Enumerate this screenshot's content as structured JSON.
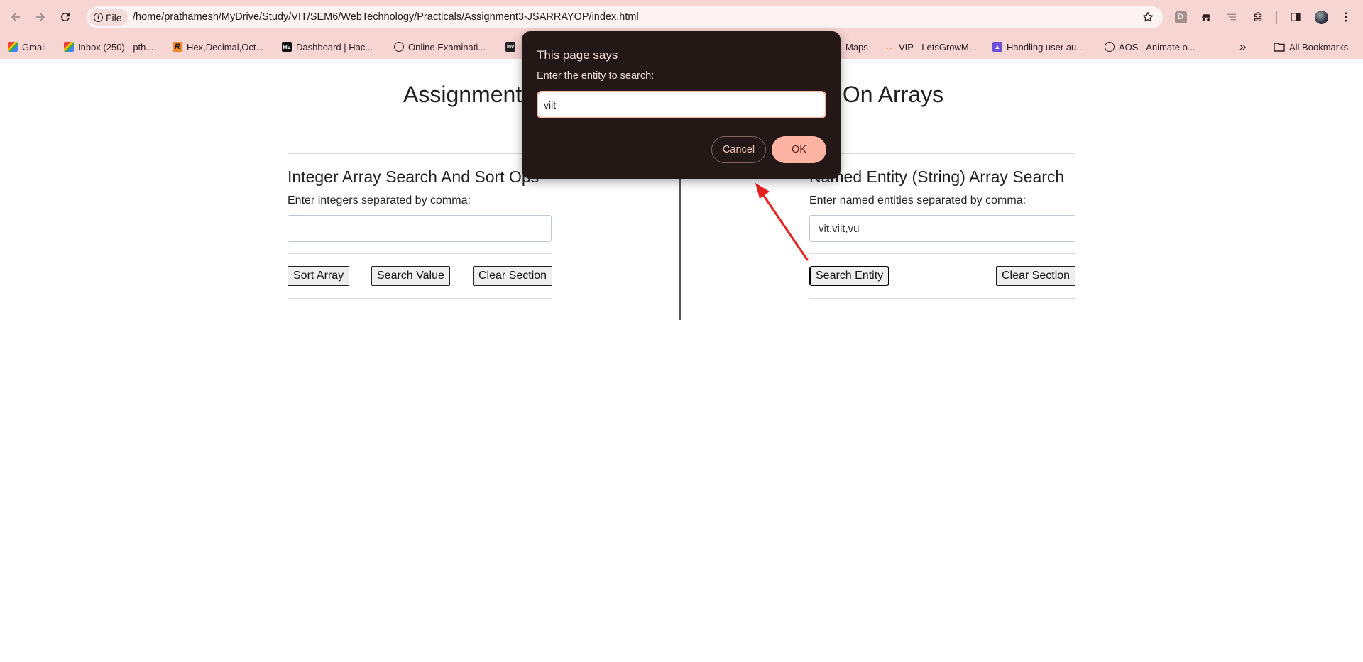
{
  "browser": {
    "site_chip": "File",
    "url": "/home/prathamesh/MyDrive/Study/VIT/SEM6/WebTechnology/Practicals/Assignment3-JSARRAYOP/index.html",
    "extension_letter": "D",
    "bookmarks": [
      {
        "label": "Gmail",
        "icon": "gmail-icon"
      },
      {
        "label": "Inbox (250) - pth...",
        "icon": "gmail-icon"
      },
      {
        "label": "Hex,Decimal,Oct...",
        "icon": "r-logo-icon"
      },
      {
        "label": "Dashboard | Hac...",
        "icon": "hackerearth-icon"
      },
      {
        "label": "Online Examinati...",
        "icon": "globe-icon"
      },
      {
        "label": "Maps",
        "icon": "maps-icon"
      },
      {
        "label": "VIP - LetsGrowM...",
        "icon": "arrow-icon"
      },
      {
        "label": "Handling user au...",
        "icon": "rocket-icon"
      },
      {
        "label": "AOS - Animate o...",
        "icon": "globe-icon"
      }
    ],
    "more_bookmarks": "»",
    "all_bookmarks": "All Bookmarks"
  },
  "page": {
    "title_left": "Assignment",
    "title_right": "s On Arrays",
    "int_section": {
      "title": "Integer Array Search And Sort Ops",
      "label": "Enter integers separated by comma:",
      "value": "",
      "buttons": {
        "sort": "Sort Array",
        "search": "Search Value",
        "clear": "Clear Section"
      }
    },
    "str_section": {
      "title": "Named Entity (String) Array Search",
      "label": "Enter named entities separated by comma:",
      "value": "vit,viit,vu",
      "buttons": {
        "search": "Search Entity",
        "clear": "Clear Section"
      }
    }
  },
  "dialog": {
    "title": "This page says",
    "message": "Enter the entity to search:",
    "input_value": "viit",
    "cancel": "Cancel",
    "ok": "OK"
  },
  "colors": {
    "chrome": "#f6d5d3",
    "dialog_bg": "#231816",
    "ok_button": "#ffb4a3",
    "annotation_arrow": "#e82020"
  }
}
